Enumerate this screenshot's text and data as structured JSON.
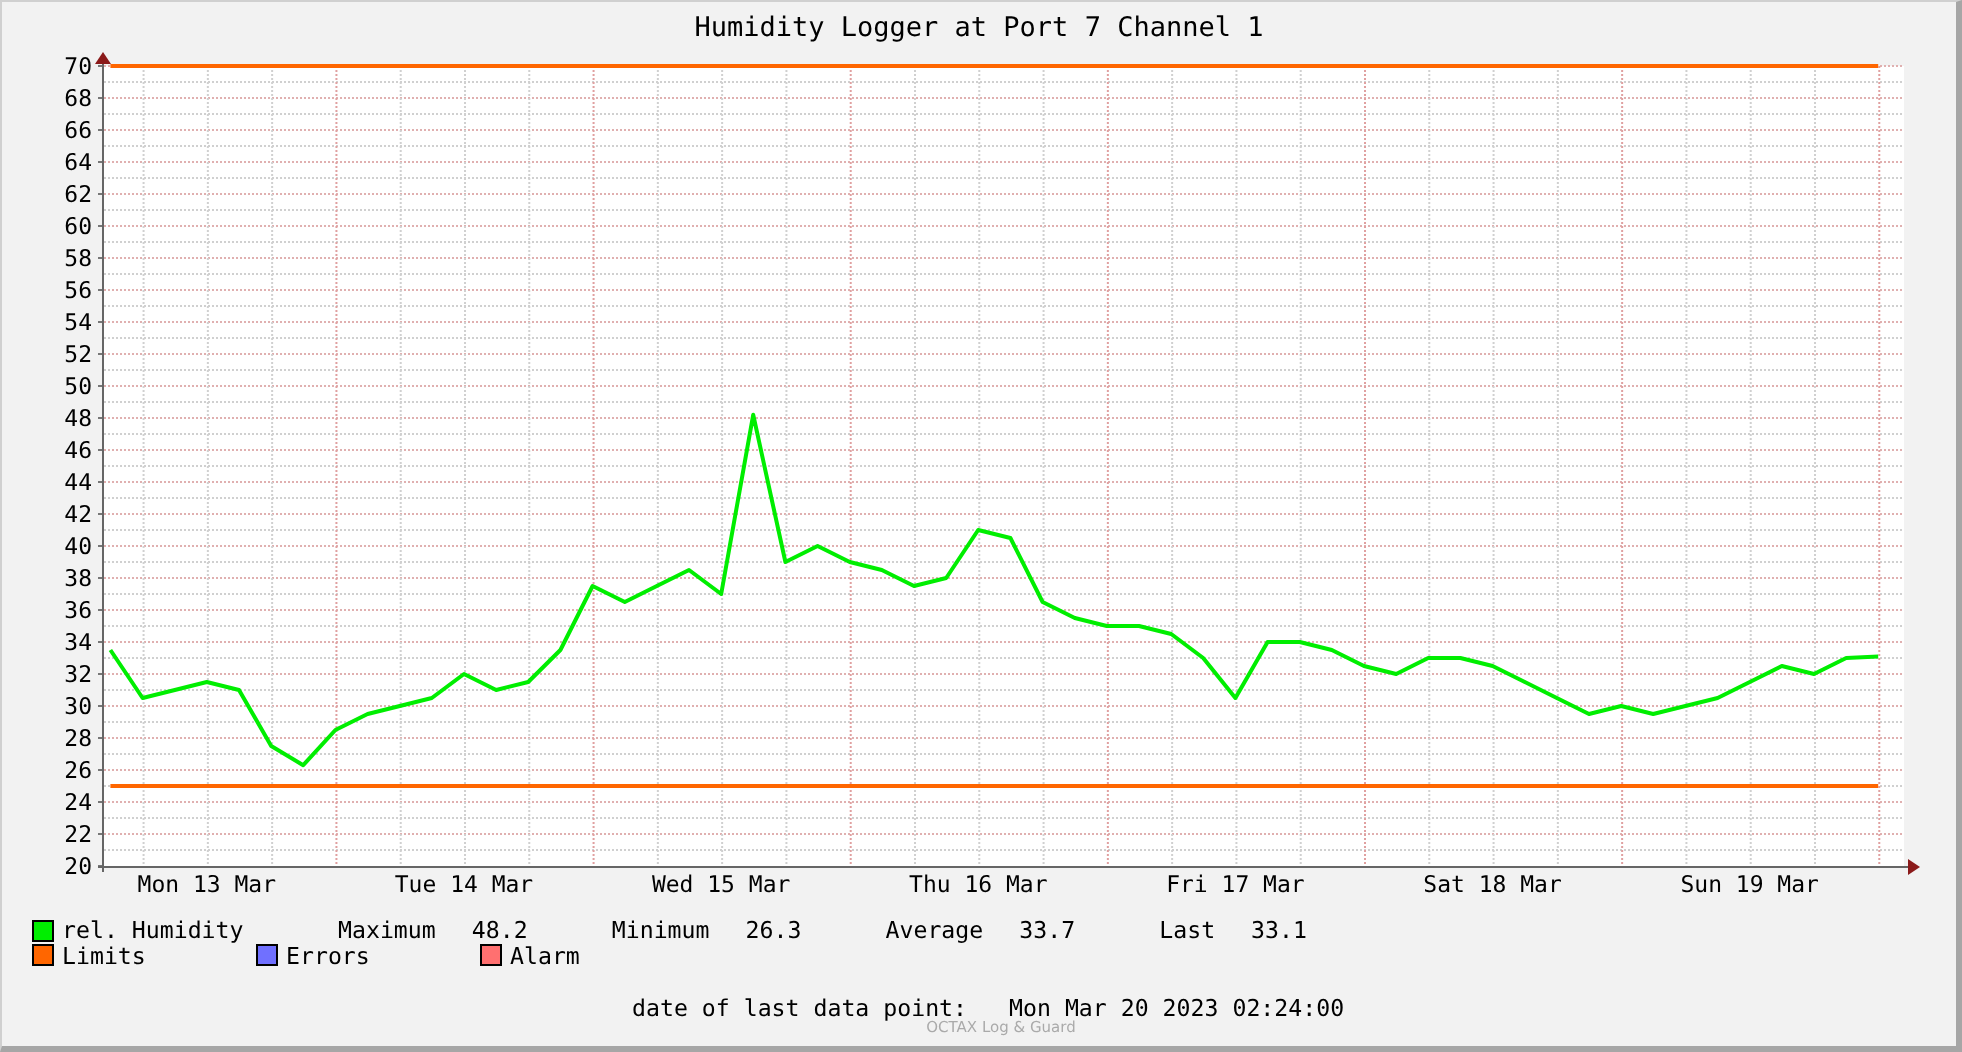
{
  "title": "Humidity Logger at Port 7 Channel 1",
  "chart": {
    "chart_data": {
      "type": "line",
      "categories": [
        null,
        null,
        null,
        "Mon 13 Mar",
        null,
        null,
        null,
        null,
        null,
        null,
        null,
        "Tue 14 Mar",
        null,
        null,
        null,
        null,
        null,
        null,
        null,
        "Wed 15 Mar",
        null,
        null,
        null,
        null,
        null,
        null,
        null,
        "Thu 16 Mar",
        null,
        null,
        null,
        null,
        null,
        null,
        null,
        "Fri 17 Mar",
        null,
        null,
        null,
        null,
        null,
        null,
        null,
        "Sat 18 Mar",
        null,
        null,
        null,
        null,
        null,
        null,
        null,
        "Sun 19 Mar",
        null,
        null,
        null,
        null
      ],
      "series": [
        {
          "name": "rel. Humidity",
          "color": "#00ee00",
          "values": [
            33.5,
            30.5,
            31,
            31.5,
            31,
            27.5,
            26.3,
            28.5,
            29.5,
            30,
            30.5,
            32,
            31,
            31.5,
            33.5,
            37.5,
            36.5,
            37.5,
            38.5,
            37,
            48.2,
            39,
            40,
            39,
            38.5,
            37.5,
            38,
            41,
            40.5,
            36.5,
            35.5,
            35,
            35,
            34.5,
            33,
            30.5,
            34,
            34,
            33.5,
            32.5,
            32,
            33,
            33,
            32.5,
            31.5,
            30.5,
            29.5,
            30,
            29.5,
            30,
            30.5,
            31.5,
            32.5,
            32,
            33,
            33.1
          ]
        },
        {
          "name": "Limits",
          "color": "#ff6600",
          "values": [
            70,
            70,
            70,
            70,
            70,
            70,
            70,
            70,
            70,
            70,
            70,
            70,
            70,
            70,
            70,
            70,
            70,
            70,
            70,
            70,
            70,
            70,
            70,
            70,
            70,
            70,
            70,
            70,
            70,
            70,
            70,
            70,
            70,
            70,
            70,
            70,
            70,
            70,
            70,
            70,
            70,
            70,
            70,
            70,
            70,
            70,
            70,
            70,
            70,
            70,
            70,
            70,
            70,
            70,
            70,
            70
          ]
        },
        {
          "color": "#ff6600",
          "values": [
            25,
            25,
            25,
            25,
            25,
            25,
            25,
            25,
            25,
            25,
            25,
            25,
            25,
            25,
            25,
            25,
            25,
            25,
            25,
            25,
            25,
            25,
            25,
            25,
            25,
            25,
            25,
            25,
            25,
            25,
            25,
            25,
            25,
            25,
            25,
            25,
            25,
            25,
            25,
            25,
            25,
            25,
            25,
            25,
            25,
            25,
            25,
            25,
            25,
            25,
            25,
            25,
            25,
            25,
            25,
            25
          ]
        }
      ],
      "grid": true,
      "ylim": [
        20,
        70
      ],
      "yticks": [
        20,
        22,
        24,
        26,
        28,
        30,
        32,
        34,
        36,
        38,
        40,
        42,
        44,
        46,
        48,
        50,
        52,
        54,
        56,
        58,
        60,
        62,
        64,
        66,
        68,
        70
      ],
      "xlabel": null
    }
  },
  "legend": [
    {
      "kind": "series",
      "stats": [
        {
          "label": "Maximum",
          "value": "48.2"
        },
        {
          "label": "Minimum",
          "value": "26.3"
        },
        {
          "label": "Average",
          "value": "33.7"
        },
        {
          "label": "Last",
          "value": "33.1"
        }
      ]
    },
    {
      "kind": "series"
    },
    {
      "kind": "flag",
      "label": "Errors",
      "color": "#7070ff"
    },
    {
      "kind": "flag",
      "label": "Alarm",
      "color": "#ff7070"
    }
  ],
  "footer": {
    "label": "date of last data point:",
    "value": "Mon Mar 20 2023 02:24:00"
  },
  "credit": "OCTAX Log & Guard"
}
